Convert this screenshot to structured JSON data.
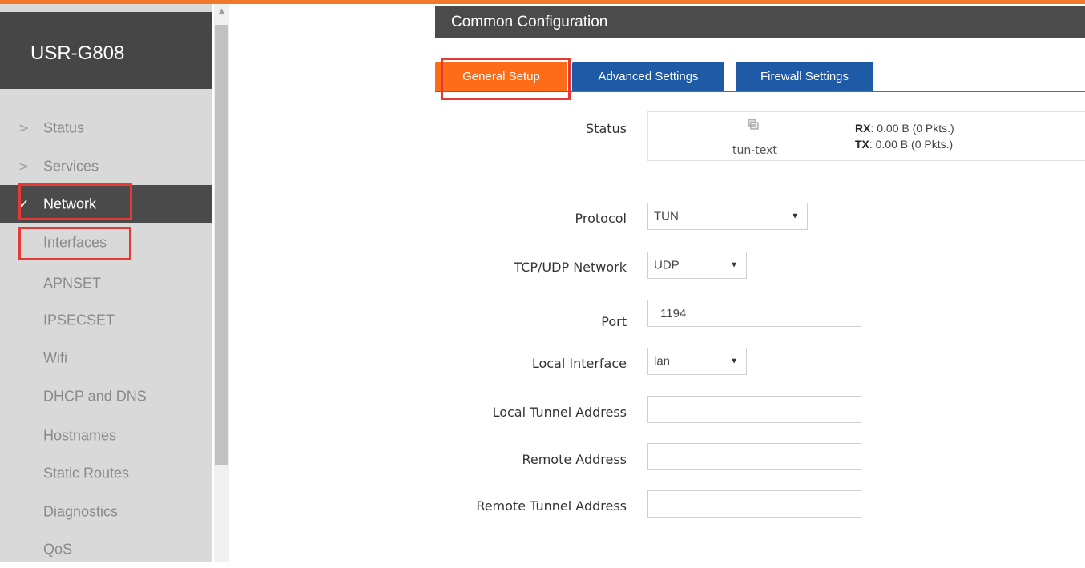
{
  "app": {
    "brand": "USR-G808"
  },
  "sidebar": {
    "items": [
      {
        "label": "Status",
        "chevron": ">"
      },
      {
        "label": "Services",
        "chevron": ">"
      },
      {
        "label": "Network",
        "chevron": "✓",
        "active": true
      }
    ],
    "sub_items": [
      {
        "label": "Interfaces"
      },
      {
        "label": "APNSET"
      },
      {
        "label": "IPSECSET"
      },
      {
        "label": "Wifi"
      },
      {
        "label": "DHCP and DNS"
      },
      {
        "label": "Hostnames"
      },
      {
        "label": "Static Routes"
      },
      {
        "label": "Diagnostics"
      },
      {
        "label": "QoS"
      }
    ]
  },
  "content": {
    "title": "Common Configuration",
    "tabs": [
      {
        "label": "General Setup",
        "active": true
      },
      {
        "label": "Advanced Settings"
      },
      {
        "label": "Firewall Settings"
      }
    ]
  },
  "form": {
    "status": {
      "label": "Status",
      "icon": "network-interface-icon",
      "interface": "tun-text",
      "rx_label": "RX",
      "rx_value": ": 0.00 B (0 Pkts.)",
      "tx_label": "TX",
      "tx_value": ": 0.00 B (0 Pkts.)"
    },
    "protocol": {
      "label": "Protocol",
      "value": "TUN"
    },
    "network": {
      "label": "TCP/UDP Network",
      "value": "UDP"
    },
    "port": {
      "label": "Port",
      "value": "1194"
    },
    "local_interface": {
      "label": "Local Interface",
      "value": "lan"
    },
    "local_tunnel": {
      "label": "Local Tunnel Address",
      "value": ""
    },
    "remote_address": {
      "label": "Remote Address",
      "value": ""
    },
    "remote_tunnel": {
      "label": "Remote Tunnel Address",
      "value": ""
    }
  },
  "colors": {
    "accent_orange": "#ff6c19",
    "tab_blue": "#1f5aa6",
    "sidebar_bg": "#d9d9d9",
    "header_dark": "#464646",
    "highlight_red": "#e53935"
  }
}
